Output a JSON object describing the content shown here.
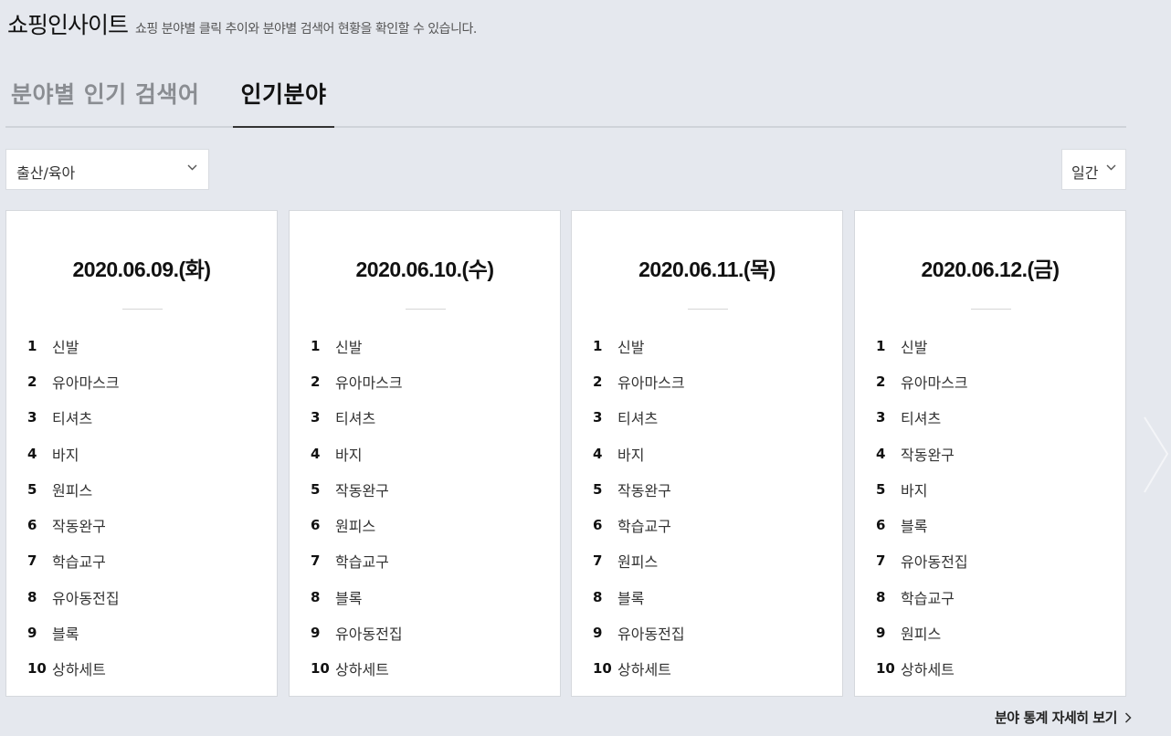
{
  "header": {
    "title": "쇼핑인사이트",
    "description": "쇼핑 분야별 클릭 추이와 분야별 검색어 현황을 확인할 수 있습니다."
  },
  "tabs": [
    {
      "label": "분야별 인기 검색어",
      "active": false
    },
    {
      "label": "인기분야",
      "active": true
    }
  ],
  "filters": {
    "category_selected": "출산/육아",
    "period_selected": "일간"
  },
  "days": [
    {
      "date": "2020.06.09.(화)",
      "items": [
        "신발",
        "유아마스크",
        "티셔츠",
        "바지",
        "원피스",
        "작동완구",
        "학습교구",
        "유아동전집",
        "블록",
        "상하세트"
      ]
    },
    {
      "date": "2020.06.10.(수)",
      "items": [
        "신발",
        "유아마스크",
        "티셔츠",
        "바지",
        "작동완구",
        "원피스",
        "학습교구",
        "블록",
        "유아동전집",
        "상하세트"
      ]
    },
    {
      "date": "2020.06.11.(목)",
      "items": [
        "신발",
        "유아마스크",
        "티셔츠",
        "바지",
        "작동완구",
        "학습교구",
        "원피스",
        "블록",
        "유아동전집",
        "상하세트"
      ]
    },
    {
      "date": "2020.06.12.(금)",
      "items": [
        "신발",
        "유아마스크",
        "티셔츠",
        "작동완구",
        "바지",
        "블록",
        "유아동전집",
        "학습교구",
        "원피스",
        "상하세트"
      ]
    }
  ],
  "ranks": [
    "1",
    "2",
    "3",
    "4",
    "5",
    "6",
    "7",
    "8",
    "9",
    "10"
  ],
  "more_link": "분야 통계 자세히 보기",
  "icons": {
    "dropdown": "chevron-down-icon",
    "more": "chevron-right-icon",
    "next": "chevron-right-icon"
  }
}
